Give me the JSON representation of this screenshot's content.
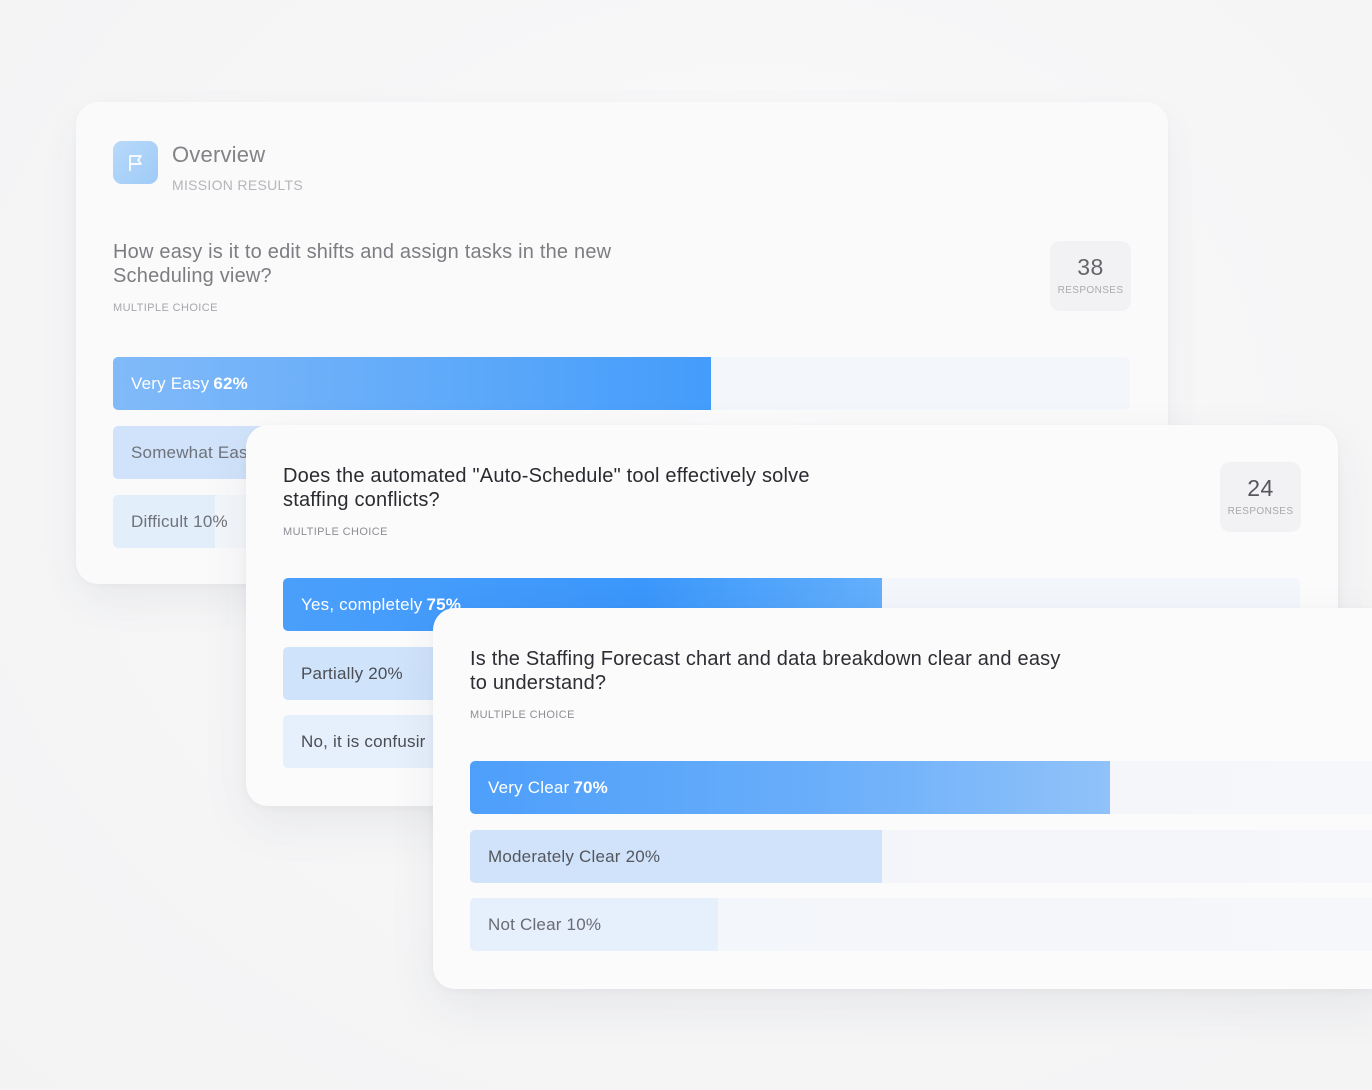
{
  "overview": {
    "title": "Overview",
    "subtitle": "MISSION RESULTS",
    "icon": "flag-icon"
  },
  "colors": {
    "accent": "#3b99fb",
    "accent_light": "#c9e1fb",
    "track": "#f3f6fb"
  },
  "questions": [
    {
      "text": "How easy is it to edit shifts and assign tasks in the new Scheduling view?",
      "type": "MULTIPLE CHOICE",
      "responses": "38",
      "responses_label": "RESPONSES",
      "options": [
        {
          "label": "Very Easy",
          "pct": "62%",
          "value": 62
        },
        {
          "label": "Somewhat Eas",
          "pct": "",
          "value": 28
        },
        {
          "label": "Difficult",
          "pct": "10%",
          "value": 10
        }
      ]
    },
    {
      "text": "Does the automated \"Auto-Schedule\" tool effectively solve staffing conflicts?",
      "type": "MULTIPLE CHOICE",
      "responses": "24",
      "responses_label": "RESPONSES",
      "options": [
        {
          "label": "Yes, completely",
          "pct": "75%",
          "value": 75
        },
        {
          "label": "Partially",
          "pct": "20%",
          "value": 20
        },
        {
          "label": "No, it is confusir",
          "pct": "",
          "value": 5
        }
      ]
    },
    {
      "text": "Is the Staffing Forecast chart and data breakdown clear and easy to understand?",
      "type": "MULTIPLE CHOICE",
      "options": [
        {
          "label": "Very Clear",
          "pct": "70%",
          "value": 70
        },
        {
          "label": "Moderately Clear",
          "pct": "20%",
          "value": 20
        },
        {
          "label": "Not Clear",
          "pct": "10%",
          "value": 10
        }
      ]
    }
  ]
}
